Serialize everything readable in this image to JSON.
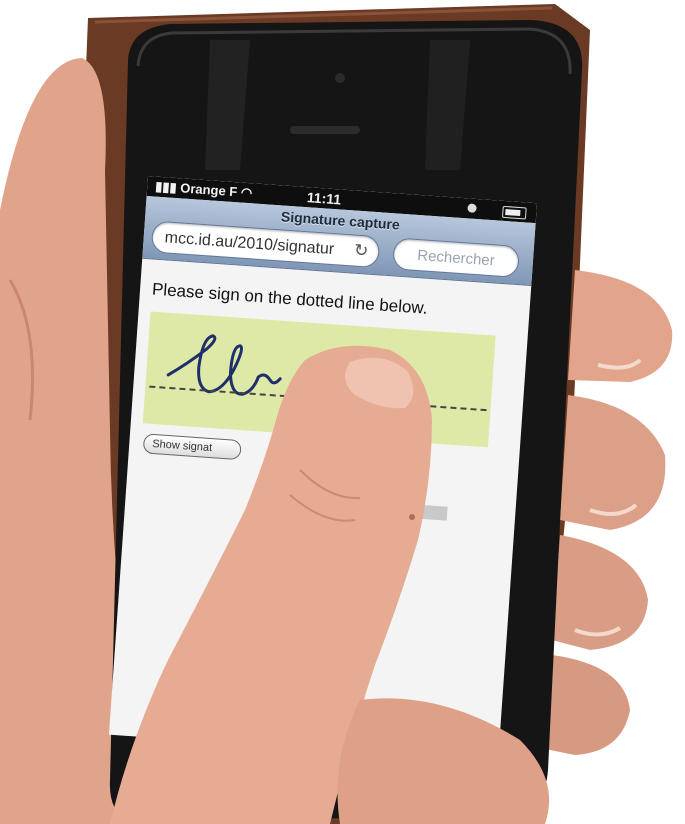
{
  "status_bar": {
    "carrier": "Orange F",
    "time": "11:11"
  },
  "browser": {
    "page_title": "Signature capture",
    "url": "mcc.id.au/2010/signatur",
    "search_placeholder": "Rechercher"
  },
  "content": {
    "instruction": "Please sign on the dotted line below.",
    "show_button_label": "Show signat"
  },
  "colors": {
    "signature_pad": "#dfe9a7",
    "browser_chrome": "#8fa6c3",
    "phone_body": "#151515",
    "case": "#6a3a24",
    "skin": "#e3a58c"
  },
  "icons": {
    "signal": "signal-bars-icon",
    "wifi": "wifi-icon",
    "clock": "clock-icon",
    "bluetooth": "bluetooth-icon",
    "battery": "battery-icon",
    "reload": "reload-icon"
  }
}
